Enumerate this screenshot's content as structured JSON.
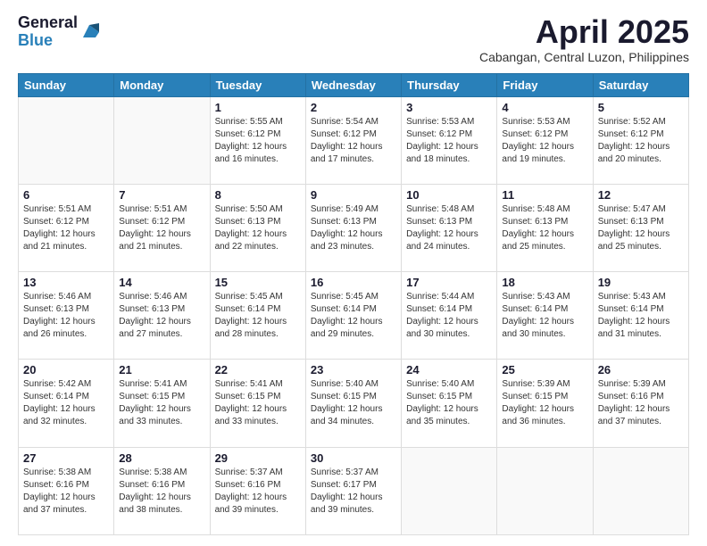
{
  "header": {
    "logo_general": "General",
    "logo_blue": "Blue",
    "month_title": "April 2025",
    "location": "Cabangan, Central Luzon, Philippines"
  },
  "days_of_week": [
    "Sunday",
    "Monday",
    "Tuesday",
    "Wednesday",
    "Thursday",
    "Friday",
    "Saturday"
  ],
  "weeks": [
    [
      {
        "num": "",
        "detail": ""
      },
      {
        "num": "",
        "detail": ""
      },
      {
        "num": "1",
        "detail": "Sunrise: 5:55 AM\nSunset: 6:12 PM\nDaylight: 12 hours\nand 16 minutes."
      },
      {
        "num": "2",
        "detail": "Sunrise: 5:54 AM\nSunset: 6:12 PM\nDaylight: 12 hours\nand 17 minutes."
      },
      {
        "num": "3",
        "detail": "Sunrise: 5:53 AM\nSunset: 6:12 PM\nDaylight: 12 hours\nand 18 minutes."
      },
      {
        "num": "4",
        "detail": "Sunrise: 5:53 AM\nSunset: 6:12 PM\nDaylight: 12 hours\nand 19 minutes."
      },
      {
        "num": "5",
        "detail": "Sunrise: 5:52 AM\nSunset: 6:12 PM\nDaylight: 12 hours\nand 20 minutes."
      }
    ],
    [
      {
        "num": "6",
        "detail": "Sunrise: 5:51 AM\nSunset: 6:12 PM\nDaylight: 12 hours\nand 21 minutes."
      },
      {
        "num": "7",
        "detail": "Sunrise: 5:51 AM\nSunset: 6:12 PM\nDaylight: 12 hours\nand 21 minutes."
      },
      {
        "num": "8",
        "detail": "Sunrise: 5:50 AM\nSunset: 6:13 PM\nDaylight: 12 hours\nand 22 minutes."
      },
      {
        "num": "9",
        "detail": "Sunrise: 5:49 AM\nSunset: 6:13 PM\nDaylight: 12 hours\nand 23 minutes."
      },
      {
        "num": "10",
        "detail": "Sunrise: 5:48 AM\nSunset: 6:13 PM\nDaylight: 12 hours\nand 24 minutes."
      },
      {
        "num": "11",
        "detail": "Sunrise: 5:48 AM\nSunset: 6:13 PM\nDaylight: 12 hours\nand 25 minutes."
      },
      {
        "num": "12",
        "detail": "Sunrise: 5:47 AM\nSunset: 6:13 PM\nDaylight: 12 hours\nand 25 minutes."
      }
    ],
    [
      {
        "num": "13",
        "detail": "Sunrise: 5:46 AM\nSunset: 6:13 PM\nDaylight: 12 hours\nand 26 minutes."
      },
      {
        "num": "14",
        "detail": "Sunrise: 5:46 AM\nSunset: 6:13 PM\nDaylight: 12 hours\nand 27 minutes."
      },
      {
        "num": "15",
        "detail": "Sunrise: 5:45 AM\nSunset: 6:14 PM\nDaylight: 12 hours\nand 28 minutes."
      },
      {
        "num": "16",
        "detail": "Sunrise: 5:45 AM\nSunset: 6:14 PM\nDaylight: 12 hours\nand 29 minutes."
      },
      {
        "num": "17",
        "detail": "Sunrise: 5:44 AM\nSunset: 6:14 PM\nDaylight: 12 hours\nand 30 minutes."
      },
      {
        "num": "18",
        "detail": "Sunrise: 5:43 AM\nSunset: 6:14 PM\nDaylight: 12 hours\nand 30 minutes."
      },
      {
        "num": "19",
        "detail": "Sunrise: 5:43 AM\nSunset: 6:14 PM\nDaylight: 12 hours\nand 31 minutes."
      }
    ],
    [
      {
        "num": "20",
        "detail": "Sunrise: 5:42 AM\nSunset: 6:14 PM\nDaylight: 12 hours\nand 32 minutes."
      },
      {
        "num": "21",
        "detail": "Sunrise: 5:41 AM\nSunset: 6:15 PM\nDaylight: 12 hours\nand 33 minutes."
      },
      {
        "num": "22",
        "detail": "Sunrise: 5:41 AM\nSunset: 6:15 PM\nDaylight: 12 hours\nand 33 minutes."
      },
      {
        "num": "23",
        "detail": "Sunrise: 5:40 AM\nSunset: 6:15 PM\nDaylight: 12 hours\nand 34 minutes."
      },
      {
        "num": "24",
        "detail": "Sunrise: 5:40 AM\nSunset: 6:15 PM\nDaylight: 12 hours\nand 35 minutes."
      },
      {
        "num": "25",
        "detail": "Sunrise: 5:39 AM\nSunset: 6:15 PM\nDaylight: 12 hours\nand 36 minutes."
      },
      {
        "num": "26",
        "detail": "Sunrise: 5:39 AM\nSunset: 6:16 PM\nDaylight: 12 hours\nand 37 minutes."
      }
    ],
    [
      {
        "num": "27",
        "detail": "Sunrise: 5:38 AM\nSunset: 6:16 PM\nDaylight: 12 hours\nand 37 minutes."
      },
      {
        "num": "28",
        "detail": "Sunrise: 5:38 AM\nSunset: 6:16 PM\nDaylight: 12 hours\nand 38 minutes."
      },
      {
        "num": "29",
        "detail": "Sunrise: 5:37 AM\nSunset: 6:16 PM\nDaylight: 12 hours\nand 39 minutes."
      },
      {
        "num": "30",
        "detail": "Sunrise: 5:37 AM\nSunset: 6:17 PM\nDaylight: 12 hours\nand 39 minutes."
      },
      {
        "num": "",
        "detail": ""
      },
      {
        "num": "",
        "detail": ""
      },
      {
        "num": "",
        "detail": ""
      }
    ]
  ]
}
